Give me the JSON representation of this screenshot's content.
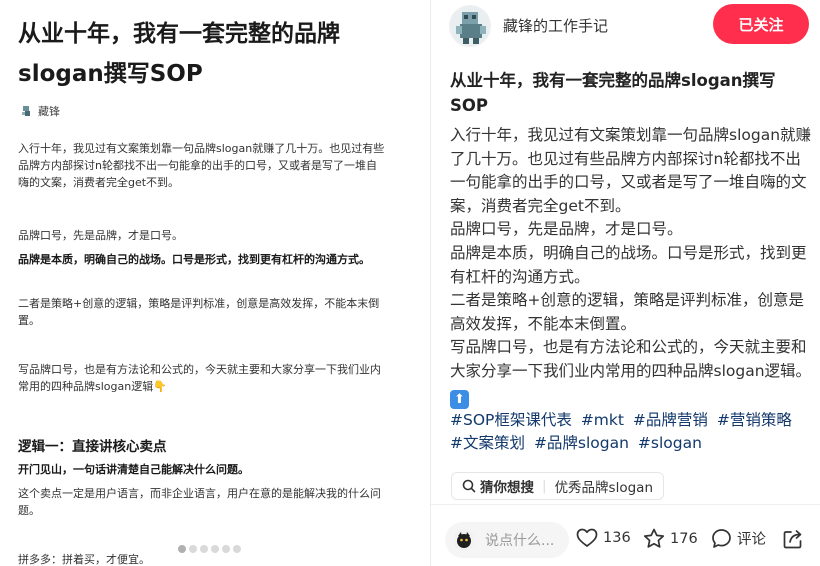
{
  "left_card": {
    "title": "从业十年，我有一套完整的品牌slogan撰写SOP",
    "author": "藏锋",
    "paragraphs": {
      "p1": "入行十年，我见过有文案策划靠一句品牌slogan就赚了几十万。也见过有些品牌方内部探讨n轮都找不出一句能拿的出手的口号，又或者是写了一堆自嗨的文案，消费者完全get不到。",
      "p2": "品牌口号，先是品牌，才是口号。",
      "p3": "品牌是本质，明确自己的战场。口号是形式，找到更有杠杆的沟通方式。",
      "p4": "二者是策略+创意的逻辑，策略是评判标准，创意是高效发挥，不能本末倒置。",
      "p5": "写品牌口号，也是有方法论和公式的，今天就主要和大家分享一下我们业内常用的四种品牌slogan逻辑👇",
      "h1": "逻辑一：直接讲核心卖点",
      "p6": "开门见山，一句话讲清楚自己能解决什么问题。",
      "p7": "这个卖点一定是用户语言，而非企业语言，用户在意的是能解决我的什么问题。",
      "p8": "拼多多：拼着买，才便宜。"
    }
  },
  "right_pane": {
    "author": "藏锋的工作手记",
    "follow_label": "已关注",
    "title": "从业十年，我有一套完整的品牌slogan撰写SOP",
    "content": {
      "p1": "入行十年，我见过有文案策划靠一句品牌slogan就赚了几十万。也见过有些品牌方内部探讨n轮都找不出一句能拿的出手的口号，又或者是写了一堆自嗨的文案，消费者完全get不到。",
      "p2": "品牌口号，先是品牌，才是口号。",
      "p3": "品牌是本质，明确自己的战场。口号是形式，找到更有杠杆的沟通方式。",
      "p4": "二者是策略+创意的逻辑，策略是评判标准，创意是高效发挥，不能本末倒置。",
      "p5": "写品牌口号，也是有方法论和公式的，今天就主要和大家分享一下我们业内常用的四种品牌slogan逻辑。"
    },
    "tags": [
      "#SOP框架课代表",
      "#mkt",
      "#品牌营销",
      "#营销策略",
      "#文案策划",
      "#品牌slogan",
      "#slogan"
    ],
    "search": {
      "label": "猜你想搜",
      "query": "优秀品牌slogan"
    },
    "footer": {
      "comment_placeholder": "说点什么...",
      "likes": "136",
      "collects": "176",
      "comment_label": "评论"
    }
  },
  "colors": {
    "accent": "#ff2e4d",
    "tag": "#13386c"
  },
  "icons": [
    "search-icon",
    "heart-icon",
    "star-icon",
    "comment-icon",
    "share-icon",
    "arrow-up-emoji"
  ]
}
